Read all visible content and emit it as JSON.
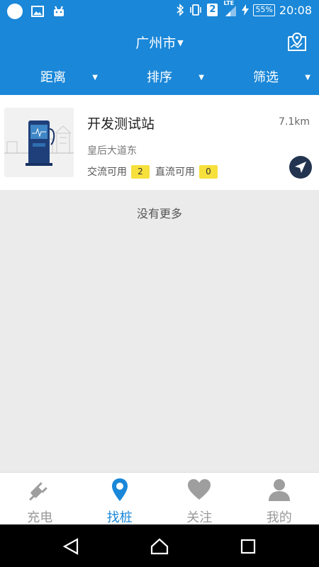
{
  "status_bar": {
    "sim": "2",
    "network": "LTE",
    "battery": "55%",
    "time": "20:08"
  },
  "header": {
    "city": "广州市",
    "filters": [
      {
        "label": "距离"
      },
      {
        "label": "排序"
      },
      {
        "label": "筛选"
      }
    ]
  },
  "station": {
    "name": "开发测试站",
    "distance": "7.1km",
    "address": "皇后大道东",
    "ac_label": "交流可用",
    "ac_count": "2",
    "dc_label": "直流可用",
    "dc_count": "0"
  },
  "list_footer": "没有更多",
  "tabs": [
    {
      "label": "充电",
      "icon": "plug-icon"
    },
    {
      "label": "找桩",
      "icon": "location-pin-icon",
      "active": true
    },
    {
      "label": "关注",
      "icon": "heart-icon"
    },
    {
      "label": "我的",
      "icon": "person-icon"
    }
  ],
  "colors": {
    "primary": "#1a87d8",
    "badge": "#f6e03b",
    "nav_button": "#22344f"
  }
}
